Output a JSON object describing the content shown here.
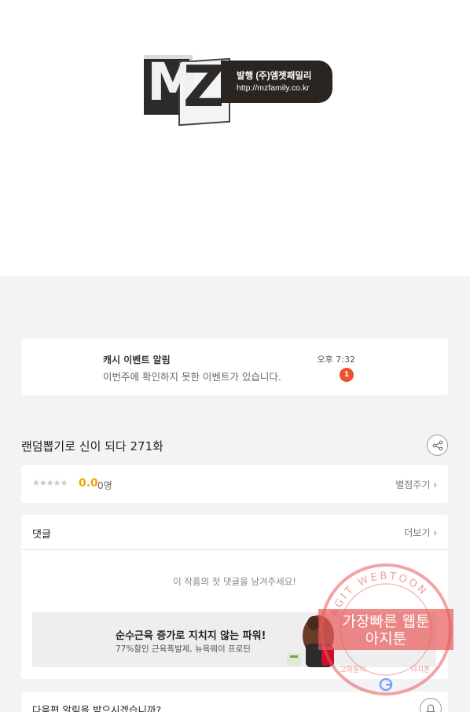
{
  "publisher": {
    "logo_letters": "MZ",
    "name": "발행 (주)엠젯패밀리",
    "url": "http://mzfamily.co.kr"
  },
  "notification": {
    "title": "캐시 이벤트 알림",
    "body": "이번주에 확인하지 못한 이벤트가 있습니다.",
    "time": "오후 7:32",
    "badge_count": "1"
  },
  "episode": {
    "title": "랜덤뽑기로 신이 되다 271화",
    "share_icon": "share-icon"
  },
  "rating": {
    "stars": "★★★★★",
    "score": "0.0",
    "count": "0명",
    "rate_label": "별점주기 ›"
  },
  "comments": {
    "title": "댓글",
    "more_label": "더보기 ›",
    "empty_text": "이 작품의 첫 댓글을 남겨주세요!"
  },
  "ad": {
    "title": "순수근육 증가로 지치지 않는 파워!",
    "subtitle": "77%할인 근육폭발제, 뉴욕웨이 프로틴"
  },
  "alarm": {
    "text": "다음편 알림을 받으시겠습니까?",
    "icon": "bell-icon"
  },
  "watermark": {
    "ring_text": "AGIT WEBTOON",
    "line1": "가장빠른 웹툰",
    "line2": "아지툰",
    "bottom_left": "고화질의",
    "bottom_right": "아지툰"
  },
  "colors": {
    "accent_orange": "#f0a500",
    "badge_red": "#e9532f",
    "watermark_red": "#e85a5a"
  }
}
